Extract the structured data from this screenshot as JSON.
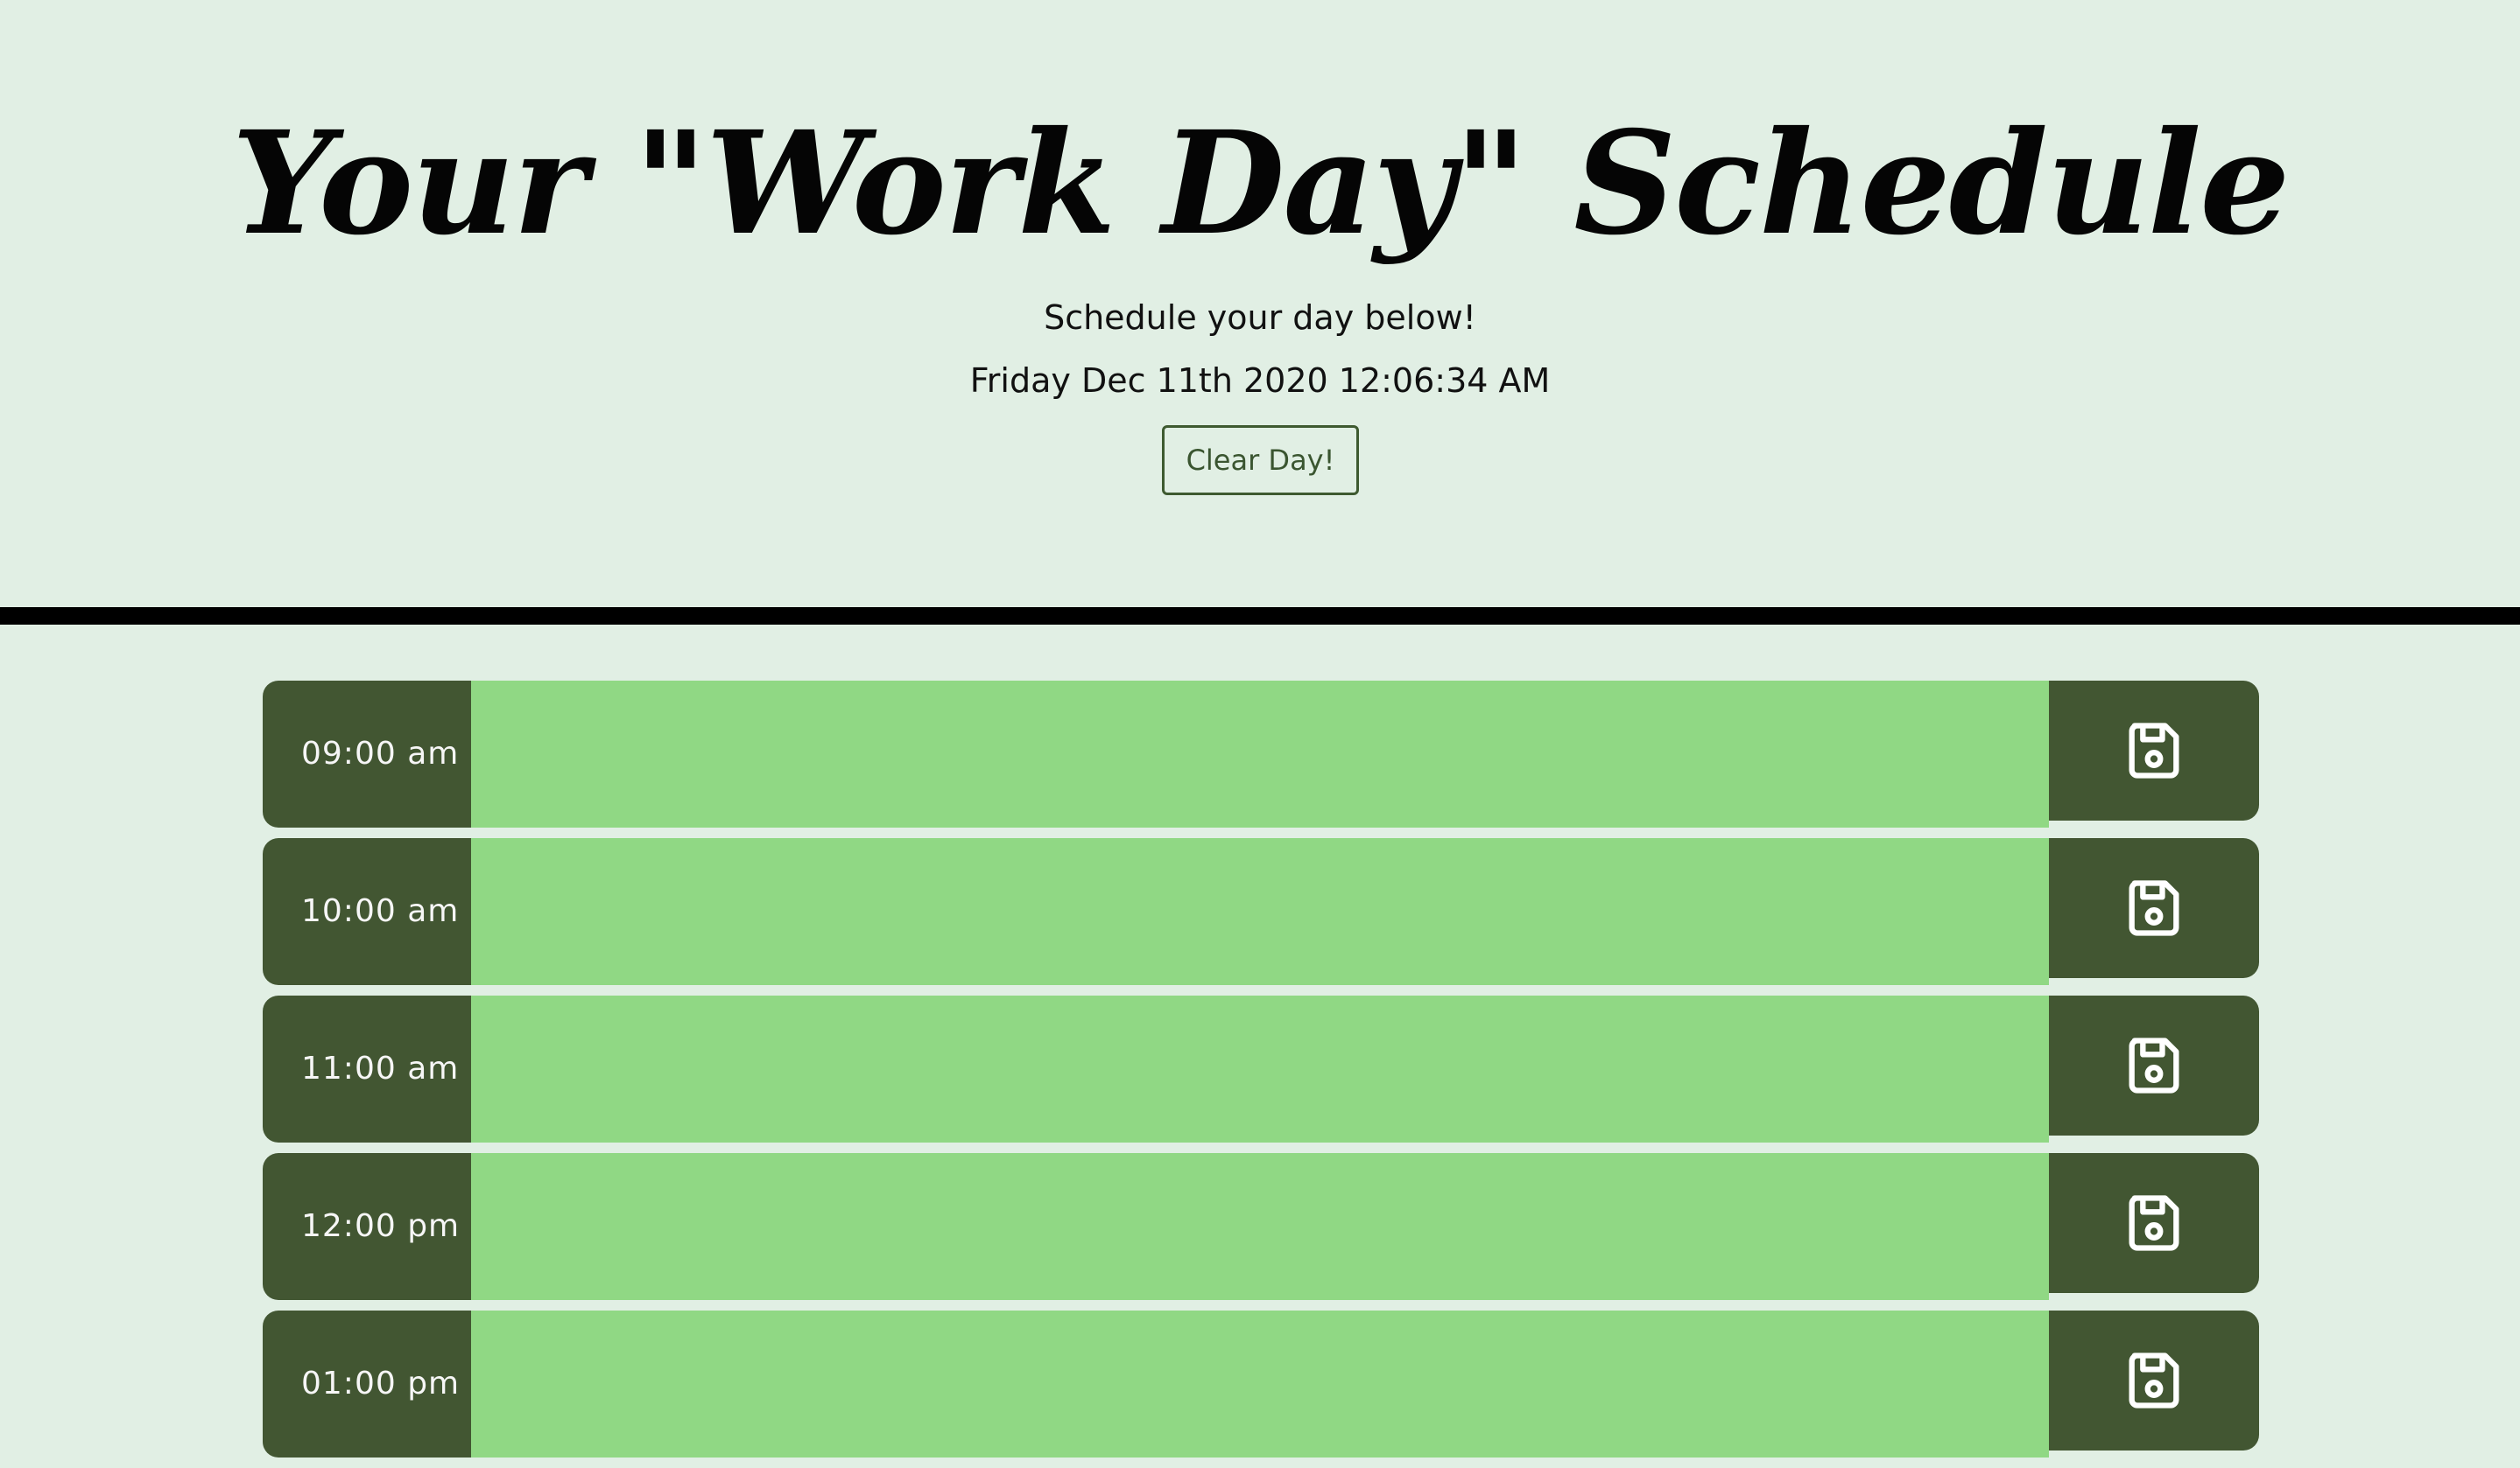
{
  "header": {
    "title": "Your \"Work Day\" Schedule",
    "subtitle": "Schedule your day below!",
    "datetime": "Friday Dec 11th 2020 12:06:34 AM",
    "clear_button_label": "Clear Day!"
  },
  "colors": {
    "background": "#e1efe4",
    "time_block": "#425632",
    "future_row": "#90d884",
    "divider": "#000000"
  },
  "schedule": {
    "rows": [
      {
        "hour": "09:00 am",
        "task": "",
        "save_icon": "floppy-disk-icon"
      },
      {
        "hour": "10:00 am",
        "task": "",
        "save_icon": "floppy-disk-icon"
      },
      {
        "hour": "11:00 am",
        "task": "",
        "save_icon": "floppy-disk-icon"
      },
      {
        "hour": "12:00 pm",
        "task": "",
        "save_icon": "floppy-disk-icon"
      },
      {
        "hour": "01:00 pm",
        "task": "",
        "save_icon": "floppy-disk-icon"
      }
    ]
  }
}
